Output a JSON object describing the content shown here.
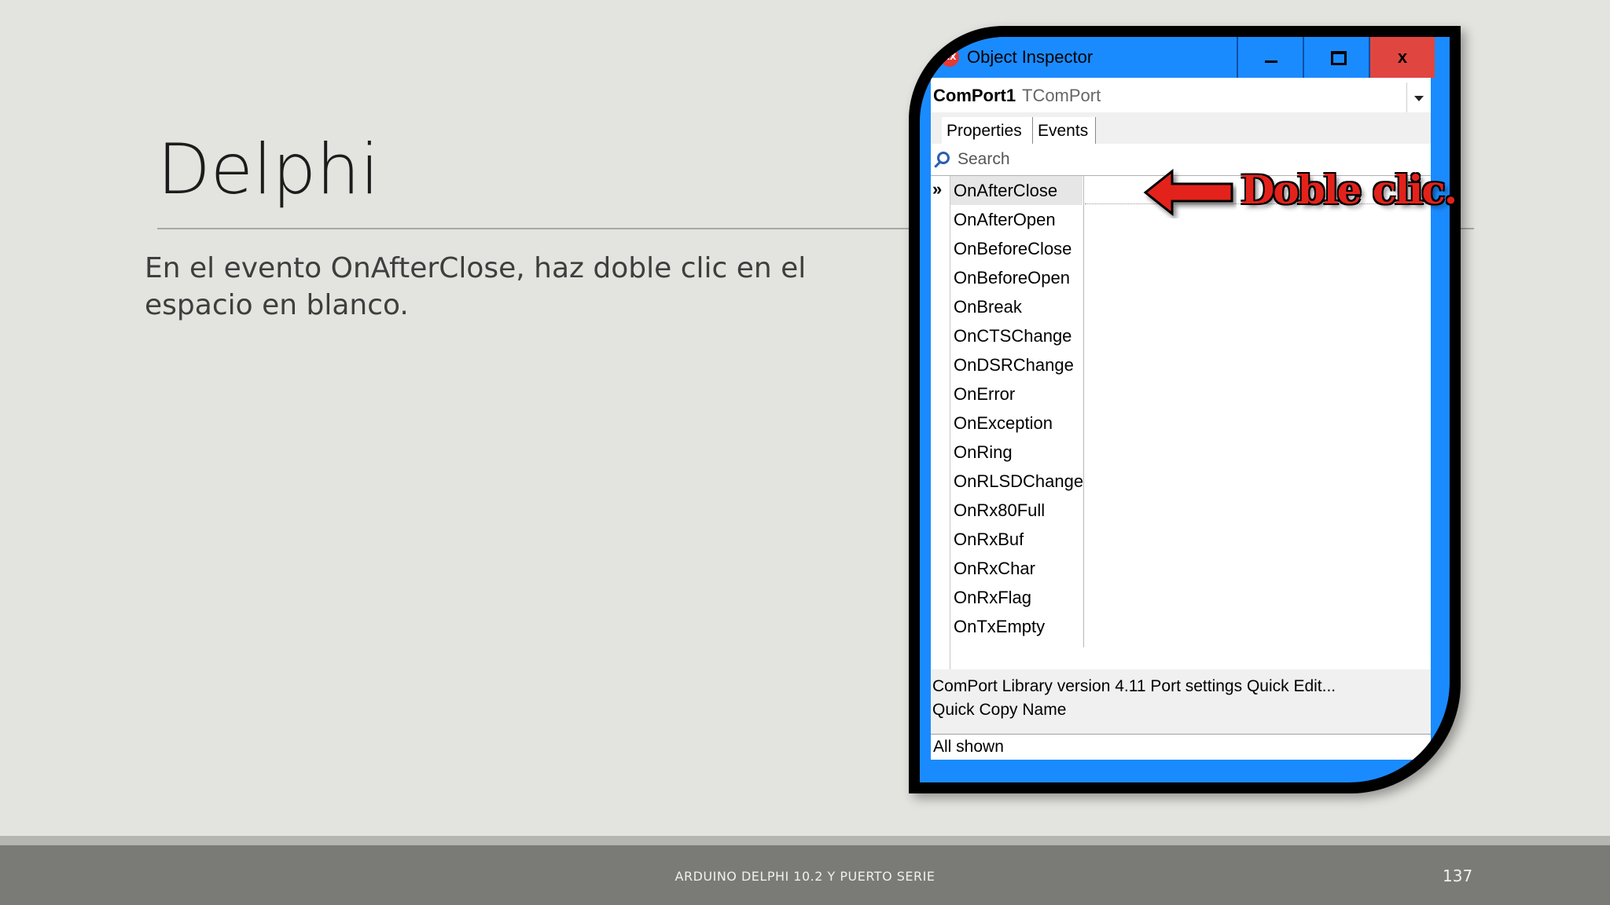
{
  "slide": {
    "title": "Delphi",
    "body": "En el evento OnAfterClose, haz doble clic en el espacio en blanco.",
    "footer": "ARDUINO DELPHI 10.2 Y PUERTO SERIE",
    "page_number": "137"
  },
  "window": {
    "title": "Object Inspector",
    "icon": "rad-studio-icon",
    "close_glyph": "x",
    "component_name": "ComPort1",
    "component_type": "TComPort",
    "tabs": [
      "Properties",
      "Events"
    ],
    "active_tab": "Events",
    "search_placeholder": "Search",
    "row_marker": "»",
    "events": [
      "OnAfterClose",
      "OnAfterOpen",
      "OnBeforeClose",
      "OnBeforeOpen",
      "OnBreak",
      "OnCTSChange",
      "OnDSRChange",
      "OnError",
      "OnException",
      "OnRing",
      "OnRLSDChange",
      "OnRx80Full",
      "OnRxBuf",
      "OnRxChar",
      "OnRxFlag",
      "OnTxEmpty"
    ],
    "selected_event": "OnAfterClose",
    "status_line_1": "ComPort Library version 4.11  Port settings  Quick Edit...",
    "status_line_2": "Quick Copy Name",
    "bottom_status": "All shown"
  },
  "annotation": {
    "text": "Doble clic.",
    "color": "#e3221b"
  },
  "colors": {
    "window_frame": "#1a8bff",
    "close_button": "#e0463f"
  }
}
